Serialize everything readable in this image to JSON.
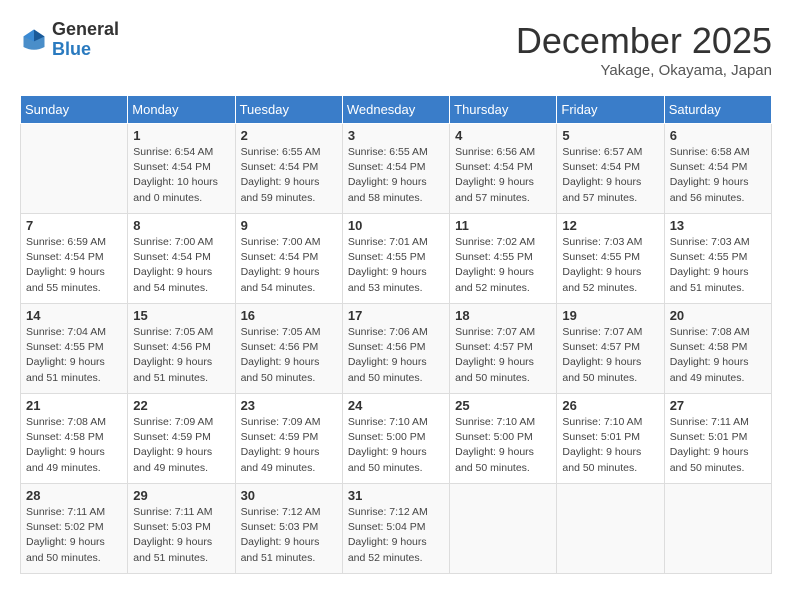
{
  "logo": {
    "general": "General",
    "blue": "Blue"
  },
  "header": {
    "month": "December 2025",
    "location": "Yakage, Okayama, Japan"
  },
  "weekdays": [
    "Sunday",
    "Monday",
    "Tuesday",
    "Wednesday",
    "Thursday",
    "Friday",
    "Saturday"
  ],
  "weeks": [
    [
      {
        "day": "",
        "info": ""
      },
      {
        "day": "1",
        "info": "Sunrise: 6:54 AM\nSunset: 4:54 PM\nDaylight: 10 hours\nand 0 minutes."
      },
      {
        "day": "2",
        "info": "Sunrise: 6:55 AM\nSunset: 4:54 PM\nDaylight: 9 hours\nand 59 minutes."
      },
      {
        "day": "3",
        "info": "Sunrise: 6:55 AM\nSunset: 4:54 PM\nDaylight: 9 hours\nand 58 minutes."
      },
      {
        "day": "4",
        "info": "Sunrise: 6:56 AM\nSunset: 4:54 PM\nDaylight: 9 hours\nand 57 minutes."
      },
      {
        "day": "5",
        "info": "Sunrise: 6:57 AM\nSunset: 4:54 PM\nDaylight: 9 hours\nand 57 minutes."
      },
      {
        "day": "6",
        "info": "Sunrise: 6:58 AM\nSunset: 4:54 PM\nDaylight: 9 hours\nand 56 minutes."
      }
    ],
    [
      {
        "day": "7",
        "info": "Sunrise: 6:59 AM\nSunset: 4:54 PM\nDaylight: 9 hours\nand 55 minutes."
      },
      {
        "day": "8",
        "info": "Sunrise: 7:00 AM\nSunset: 4:54 PM\nDaylight: 9 hours\nand 54 minutes."
      },
      {
        "day": "9",
        "info": "Sunrise: 7:00 AM\nSunset: 4:54 PM\nDaylight: 9 hours\nand 54 minutes."
      },
      {
        "day": "10",
        "info": "Sunrise: 7:01 AM\nSunset: 4:55 PM\nDaylight: 9 hours\nand 53 minutes."
      },
      {
        "day": "11",
        "info": "Sunrise: 7:02 AM\nSunset: 4:55 PM\nDaylight: 9 hours\nand 52 minutes."
      },
      {
        "day": "12",
        "info": "Sunrise: 7:03 AM\nSunset: 4:55 PM\nDaylight: 9 hours\nand 52 minutes."
      },
      {
        "day": "13",
        "info": "Sunrise: 7:03 AM\nSunset: 4:55 PM\nDaylight: 9 hours\nand 51 minutes."
      }
    ],
    [
      {
        "day": "14",
        "info": "Sunrise: 7:04 AM\nSunset: 4:55 PM\nDaylight: 9 hours\nand 51 minutes."
      },
      {
        "day": "15",
        "info": "Sunrise: 7:05 AM\nSunset: 4:56 PM\nDaylight: 9 hours\nand 51 minutes."
      },
      {
        "day": "16",
        "info": "Sunrise: 7:05 AM\nSunset: 4:56 PM\nDaylight: 9 hours\nand 50 minutes."
      },
      {
        "day": "17",
        "info": "Sunrise: 7:06 AM\nSunset: 4:56 PM\nDaylight: 9 hours\nand 50 minutes."
      },
      {
        "day": "18",
        "info": "Sunrise: 7:07 AM\nSunset: 4:57 PM\nDaylight: 9 hours\nand 50 minutes."
      },
      {
        "day": "19",
        "info": "Sunrise: 7:07 AM\nSunset: 4:57 PM\nDaylight: 9 hours\nand 50 minutes."
      },
      {
        "day": "20",
        "info": "Sunrise: 7:08 AM\nSunset: 4:58 PM\nDaylight: 9 hours\nand 49 minutes."
      }
    ],
    [
      {
        "day": "21",
        "info": "Sunrise: 7:08 AM\nSunset: 4:58 PM\nDaylight: 9 hours\nand 49 minutes."
      },
      {
        "day": "22",
        "info": "Sunrise: 7:09 AM\nSunset: 4:59 PM\nDaylight: 9 hours\nand 49 minutes."
      },
      {
        "day": "23",
        "info": "Sunrise: 7:09 AM\nSunset: 4:59 PM\nDaylight: 9 hours\nand 49 minutes."
      },
      {
        "day": "24",
        "info": "Sunrise: 7:10 AM\nSunset: 5:00 PM\nDaylight: 9 hours\nand 50 minutes."
      },
      {
        "day": "25",
        "info": "Sunrise: 7:10 AM\nSunset: 5:00 PM\nDaylight: 9 hours\nand 50 minutes."
      },
      {
        "day": "26",
        "info": "Sunrise: 7:10 AM\nSunset: 5:01 PM\nDaylight: 9 hours\nand 50 minutes."
      },
      {
        "day": "27",
        "info": "Sunrise: 7:11 AM\nSunset: 5:01 PM\nDaylight: 9 hours\nand 50 minutes."
      }
    ],
    [
      {
        "day": "28",
        "info": "Sunrise: 7:11 AM\nSunset: 5:02 PM\nDaylight: 9 hours\nand 50 minutes."
      },
      {
        "day": "29",
        "info": "Sunrise: 7:11 AM\nSunset: 5:03 PM\nDaylight: 9 hours\nand 51 minutes."
      },
      {
        "day": "30",
        "info": "Sunrise: 7:12 AM\nSunset: 5:03 PM\nDaylight: 9 hours\nand 51 minutes."
      },
      {
        "day": "31",
        "info": "Sunrise: 7:12 AM\nSunset: 5:04 PM\nDaylight: 9 hours\nand 52 minutes."
      },
      {
        "day": "",
        "info": ""
      },
      {
        "day": "",
        "info": ""
      },
      {
        "day": "",
        "info": ""
      }
    ]
  ]
}
